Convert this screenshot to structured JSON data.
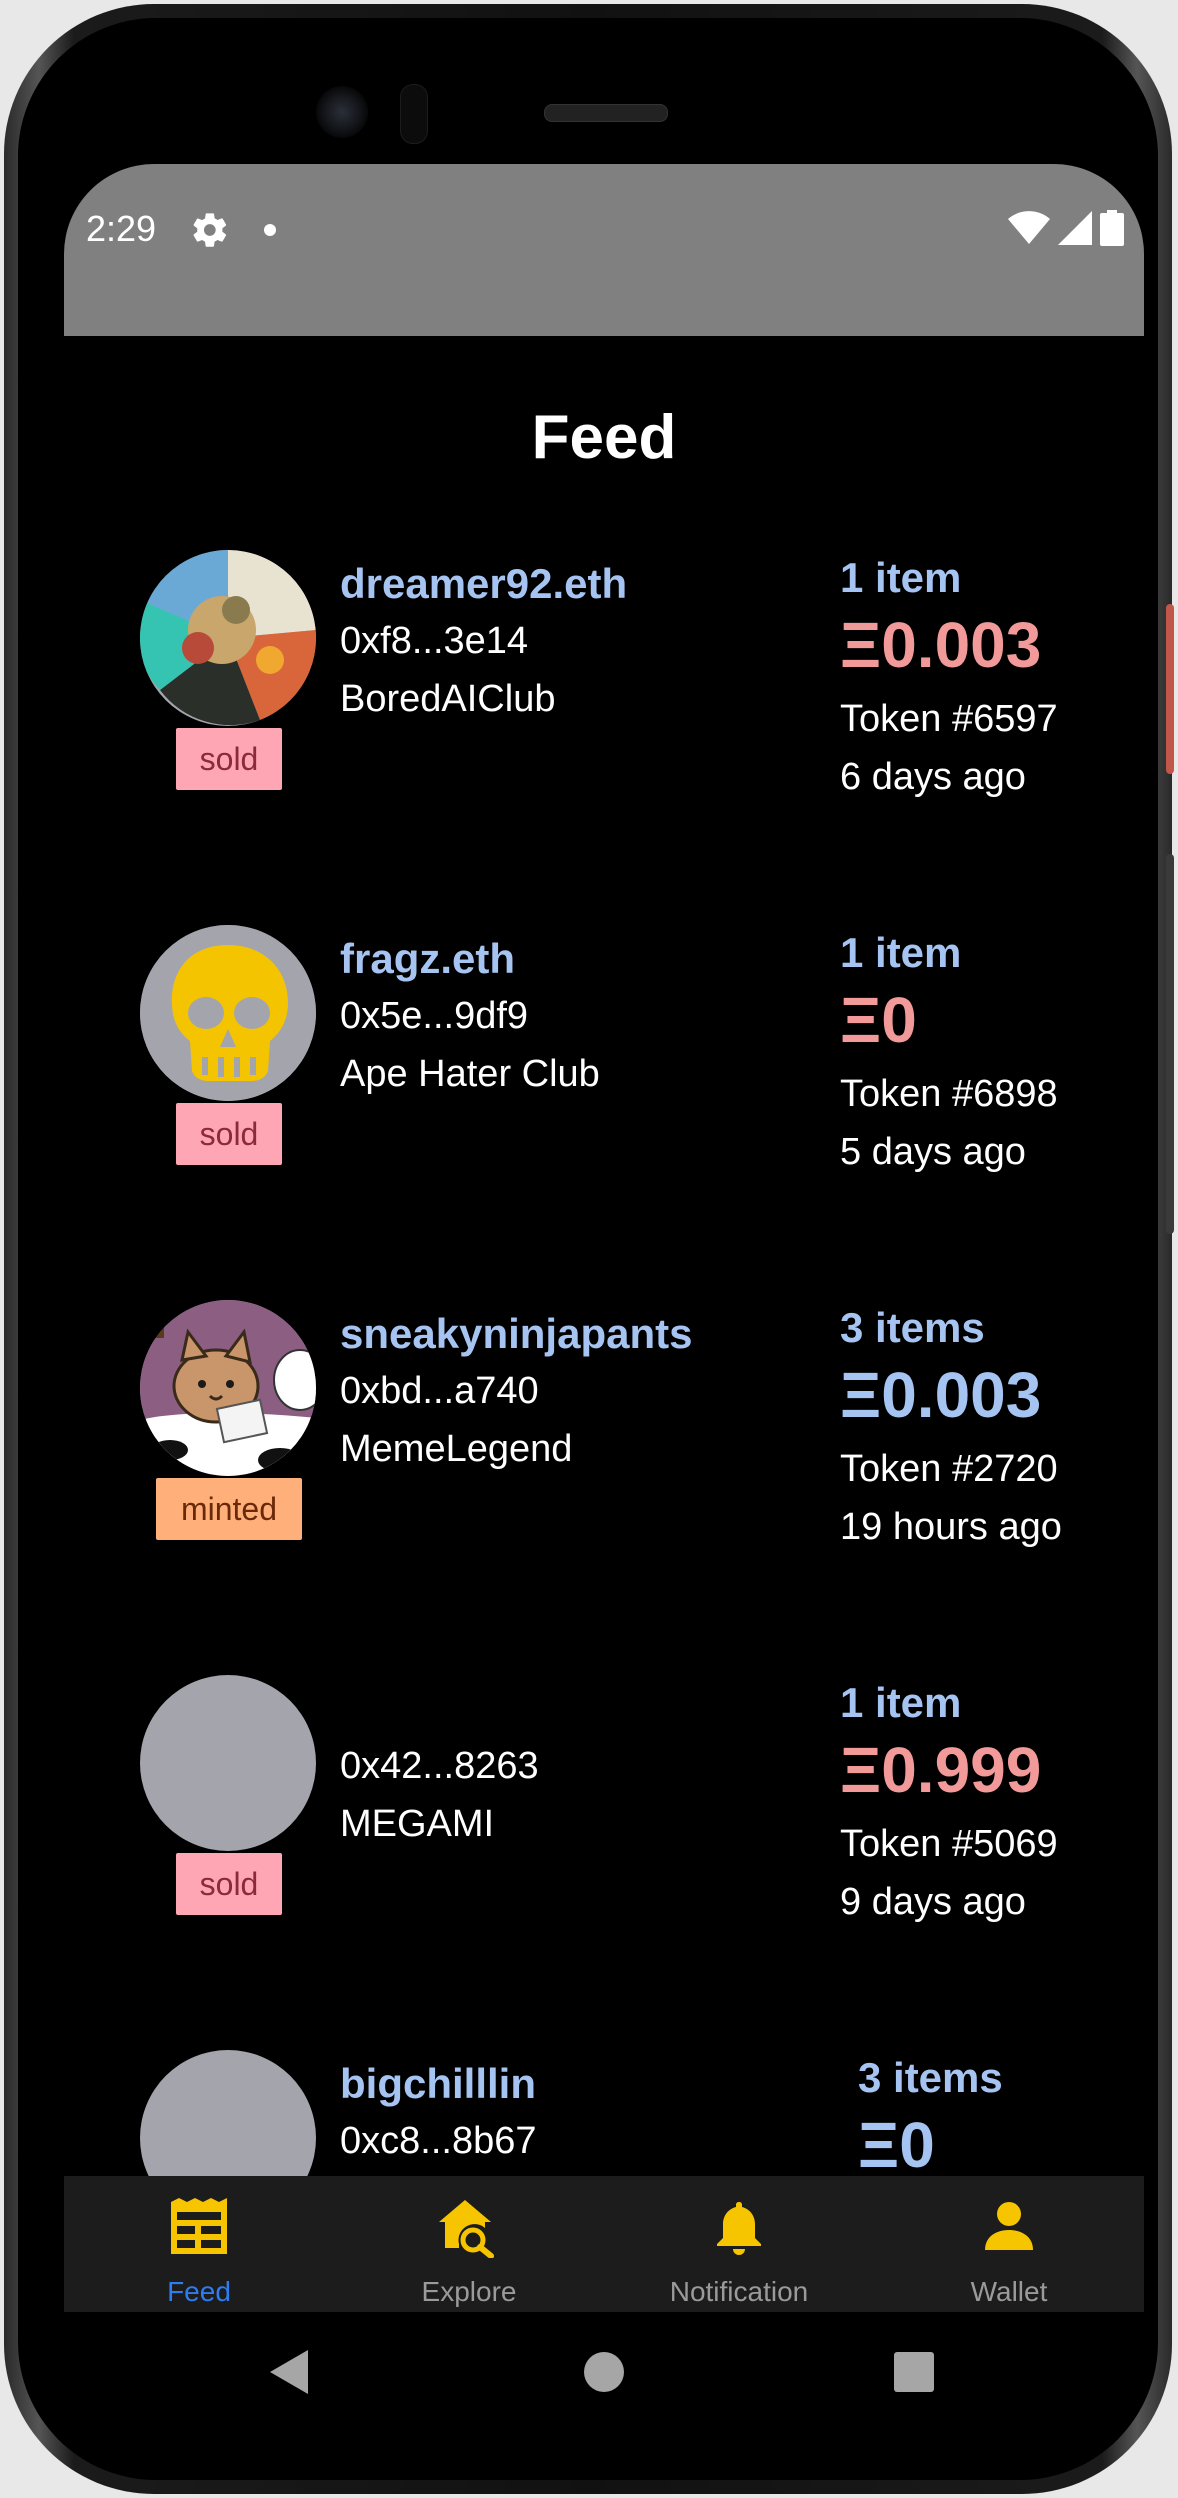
{
  "status_bar": {
    "time": "2:29"
  },
  "page": {
    "title": "Feed"
  },
  "feed": [
    {
      "name": "dreamer92.eth",
      "address": "0xf8...3e14",
      "collection": "BoredAIClub",
      "badge": "sold",
      "count": "1 item",
      "price": "Ξ0.003",
      "token": "Token #6597",
      "time": "6 days ago",
      "avatar": "nft-art-avatar"
    },
    {
      "name": "fragz.eth",
      "address": "0x5e...9df9",
      "collection": "Ape Hater Club",
      "badge": "sold",
      "count": "1 item",
      "price": "Ξ0",
      "token": "Token #6898",
      "time": "5 days ago",
      "avatar": "skull-avatar"
    },
    {
      "name": "sneakyninjapants",
      "address": "0xbd...a740",
      "collection": "MemeLegend",
      "badge": "minted",
      "count": "3 items",
      "price": "Ξ0.003",
      "token": "Token #2720",
      "time": "19 hours ago",
      "avatar": "cat-avatar"
    },
    {
      "name": "",
      "address": "0x42...8263",
      "collection": "MEGAMI",
      "badge": "sold",
      "count": "1 item",
      "price": "Ξ0.999",
      "token": "Token #5069",
      "time": "9 days ago",
      "avatar": "placeholder-avatar"
    },
    {
      "name": "bigchilllin",
      "address": "0xc8...8b67",
      "collection": "",
      "badge": "",
      "count": "3 items",
      "price": "Ξ0",
      "token": "",
      "time": "",
      "avatar": "placeholder-avatar"
    }
  ],
  "tabs": [
    {
      "label": "Feed",
      "icon": "feed-icon",
      "active": true
    },
    {
      "label": "Explore",
      "icon": "explore-icon",
      "active": false
    },
    {
      "label": "Notification",
      "icon": "bell-icon",
      "active": false
    },
    {
      "label": "Wallet",
      "icon": "user-icon",
      "active": false
    }
  ],
  "colors": {
    "sold_badge_bg": "#ffa6b4",
    "sold_badge_text": "#8a2a3a",
    "minted_badge_bg": "#ffb07a",
    "minted_badge_text": "#6a2a0a",
    "name_blue": "#a6c4f2",
    "price_sold": "#f29a9a",
    "price_minted": "#a6c4f2",
    "tab_active": "#2d7cf0",
    "tab_icon": "#f7c400"
  }
}
